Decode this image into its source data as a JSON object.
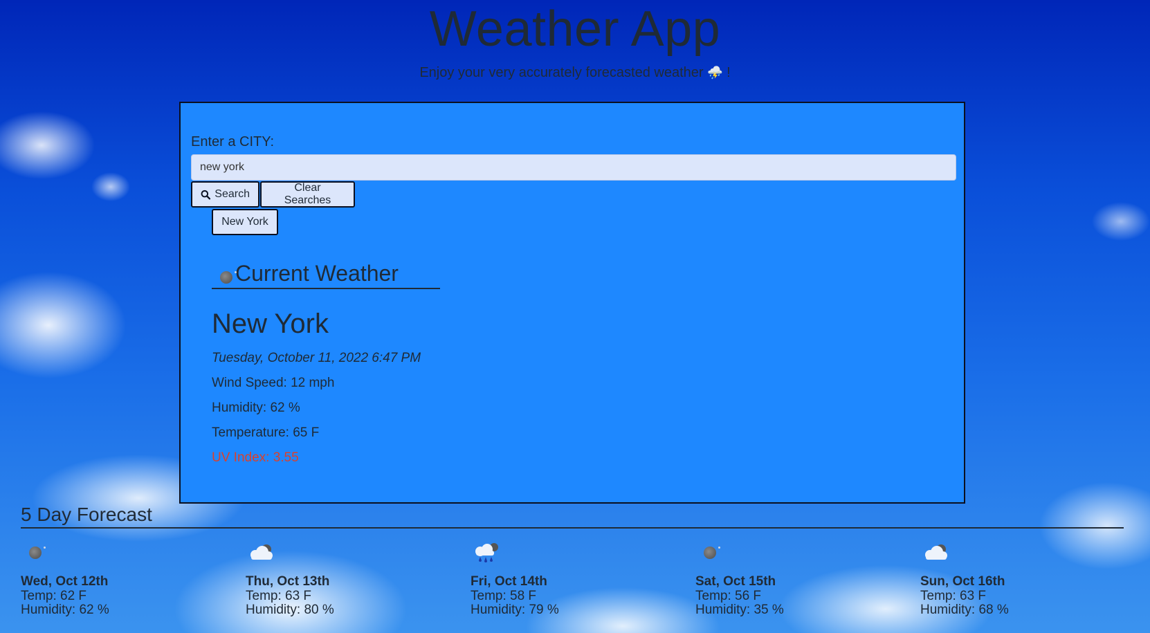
{
  "header": {
    "title": "Weather App",
    "subtitle": "Enjoy your very accurately forecasted weather",
    "subtitle_emoji": "⛈️",
    "subtitle_end": "!"
  },
  "search": {
    "label": "Enter a CITY:",
    "value": "new york",
    "search_button": "Search",
    "search_icon": "search-icon",
    "clear_button": "Clear Searches",
    "history": [
      "New York"
    ]
  },
  "current": {
    "heading": "Current Weather",
    "icon": "moon-icon",
    "city": "New York",
    "datetime": "Tuesday, October 11, 2022 6:47 PM",
    "wind": "Wind Speed: 12 mph",
    "humidity": "Humidity: 62 %",
    "temperature": "Temperature: 65 F",
    "uv": "UV Index: 3.55",
    "uv_color": "#d9412c"
  },
  "forecast": {
    "heading": "5 Day Forecast",
    "days": [
      {
        "date": "Wed, Oct 12th",
        "temp": "Temp: 62 F",
        "humidity": "Humidity: 62 %",
        "icon": "moon-icon"
      },
      {
        "date": "Thu, Oct 13th",
        "temp": "Temp: 63 F",
        "humidity": "Humidity: 80 %",
        "icon": "cloud-icon"
      },
      {
        "date": "Fri, Oct 14th",
        "temp": "Temp: 58 F",
        "humidity": "Humidity: 79 %",
        "icon": "rain-icon"
      },
      {
        "date": "Sat, Oct 15th",
        "temp": "Temp: 56 F",
        "humidity": "Humidity: 35 %",
        "icon": "moon-icon"
      },
      {
        "date": "Sun, Oct 16th",
        "temp": "Temp: 63 F",
        "humidity": "Humidity: 68 %",
        "icon": "cloud-icon"
      }
    ]
  }
}
